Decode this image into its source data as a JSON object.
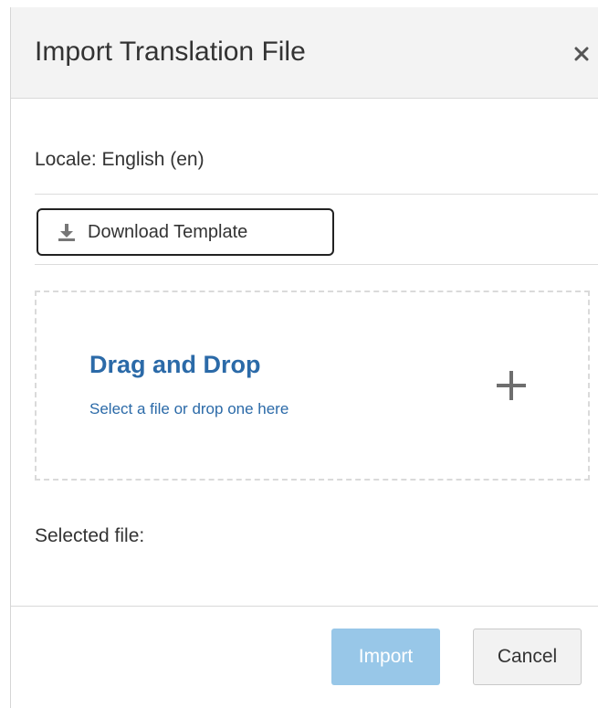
{
  "dialog": {
    "title": "Import Translation File",
    "close_icon": "close-icon"
  },
  "locale": {
    "text": "Locale: English (en)"
  },
  "download": {
    "label": "Download Template",
    "icon": "download-icon"
  },
  "dropzone": {
    "title": "Drag and Drop",
    "subtitle": "Select a file or drop one here",
    "icon": "plus-icon"
  },
  "selected_file": {
    "label": "Selected file:"
  },
  "footer": {
    "import_label": "Import",
    "cancel_label": "Cancel"
  },
  "colors": {
    "accent": "#2b6aa8",
    "import_disabled": "#98c7e8",
    "header_bg": "#f3f3f3"
  }
}
